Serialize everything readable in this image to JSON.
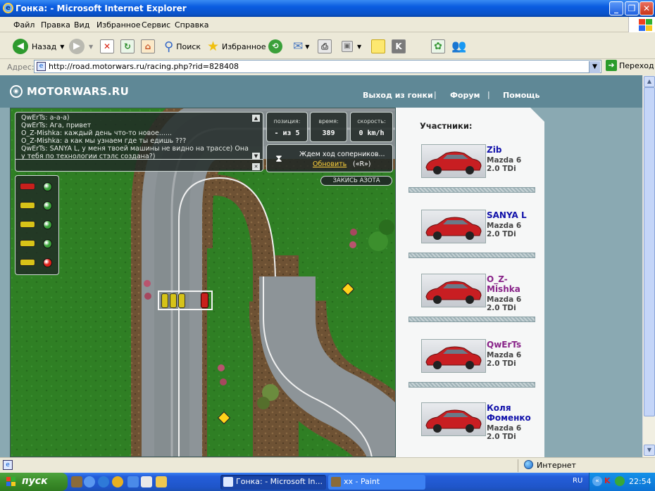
{
  "window": {
    "title": "Гонка: - Microsoft Internet Explorer"
  },
  "menu": {
    "items": [
      "Файл",
      "Правка",
      "Вид",
      "Избранное",
      "Сервис",
      "Справка"
    ]
  },
  "toolbar": {
    "back": "Назад",
    "search": "Поиск",
    "favorites": "Избранное"
  },
  "address": {
    "label": "Адрес:",
    "url": "http://road.motorwars.ru/racing.php?rid=828408",
    "go": "Переход"
  },
  "site": {
    "logo": "MOTORWARS.RU",
    "nav": [
      "Выход из гонки",
      "Форум",
      "Помощь"
    ]
  },
  "chat": {
    "lines": [
      {
        "user": "QwErTs",
        "text": "а-а-а)"
      },
      {
        "user": "QwErTs",
        "text": "Ага, привет"
      },
      {
        "user": "O_Z-Mishka",
        "text": "каждый день что-то новое......"
      },
      {
        "user": "O_Z-Mishka",
        "text": "а как мы узнаем где ты едишь ???"
      },
      {
        "user": "QwErTs",
        "text": "SANYA L, у меня твоей машины не видно на трассе) Она у тебя по технологии стэлс создана?)"
      }
    ]
  },
  "stats": {
    "position_label": "позиция:",
    "position_value": "- из 5",
    "time_label": "время:",
    "time_value": "389",
    "speed_label": "скорость:",
    "speed_value": "0 km/h"
  },
  "wait": {
    "text": "Ждем ход соперников...",
    "refresh": "Обновить",
    "hotkey": "(«R»)"
  },
  "nitro": {
    "label": "ЗАКИСЬ АЗОТА"
  },
  "mini_players": [
    {
      "car": "#c8201c",
      "light": "#3aa23a"
    },
    {
      "car": "#d8c418",
      "light": "#3aa23a"
    },
    {
      "car": "#d8c418",
      "light": "#3aa23a"
    },
    {
      "car": "#d8c418",
      "light": "#3aa23a"
    },
    {
      "car": "#d8c418",
      "light": "#e02018"
    }
  ],
  "participants": {
    "label": "Участники:",
    "list": [
      {
        "name": "Zib",
        "car": "Mazda 6 2.0 TDi",
        "color": "#1111aa"
      },
      {
        "name": "SANYA L",
        "car": "Mazda 6 2.0 TDi",
        "color": "#1111aa"
      },
      {
        "name": "O_Z-Mishka",
        "car": "Mazda 6 2.0 TDi",
        "color": "#882288"
      },
      {
        "name": "QwErTs",
        "car": "Mazda 6 2.0 TDi",
        "color": "#882288"
      },
      {
        "name": "Коля Фоменко",
        "car": "Mazda 6 2.0 TDi",
        "color": "#1111aa"
      }
    ]
  },
  "status": {
    "zone": "Интернет"
  },
  "taskbar": {
    "start": "пуск",
    "tasks": [
      "Гонка: - Microsoft In...",
      "xx - Paint"
    ],
    "lang": "RU",
    "time": "22:54"
  }
}
